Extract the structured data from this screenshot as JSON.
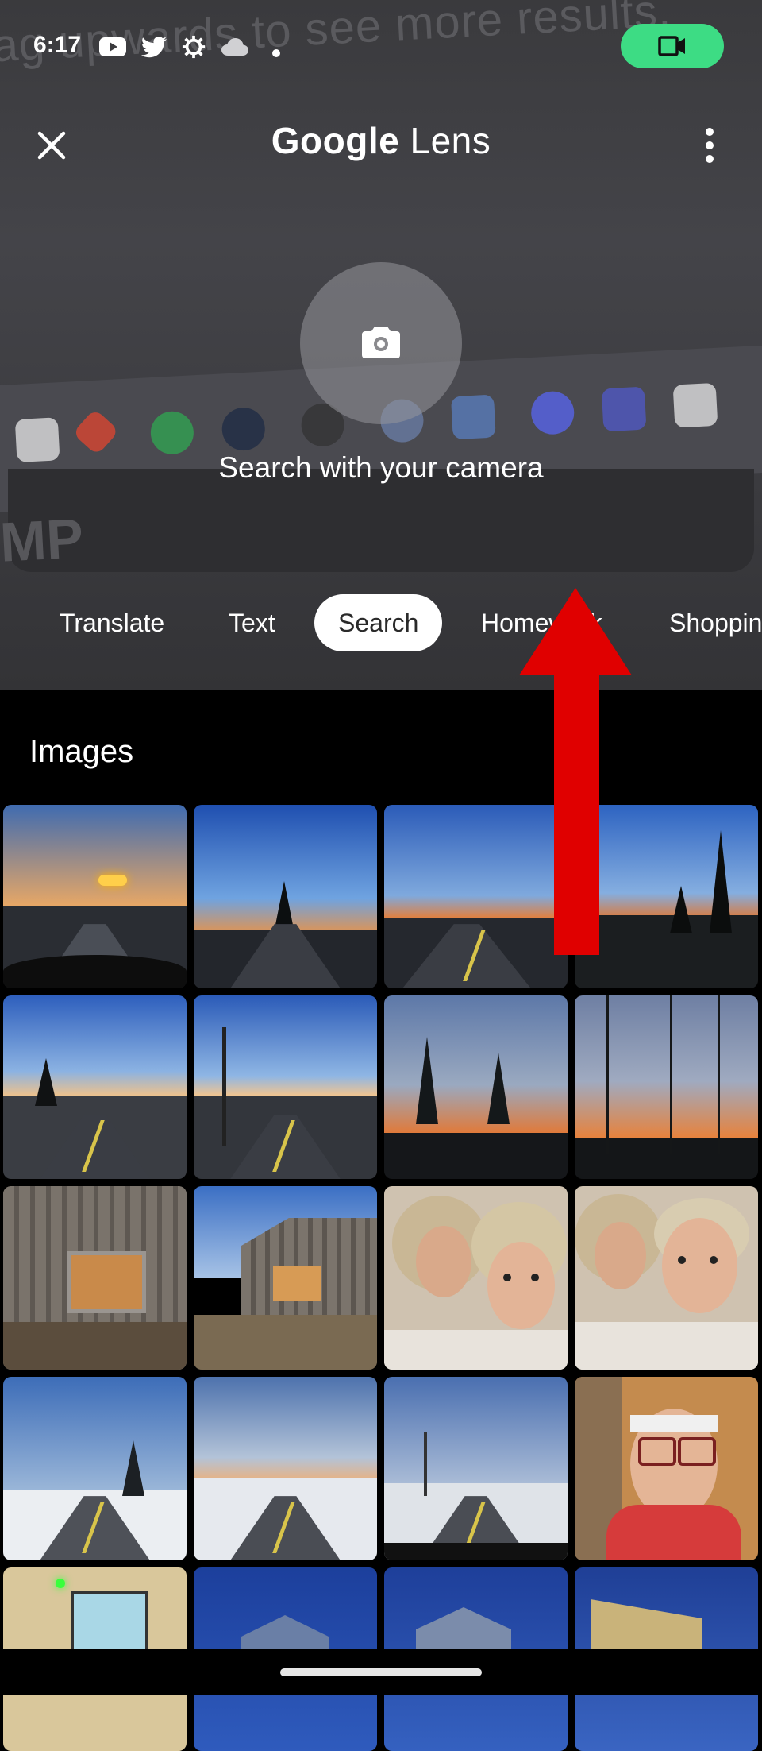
{
  "status_bar": {
    "time": "6:17",
    "icons": [
      "youtube-icon",
      "twitter-icon",
      "settings-gear-icon",
      "cloud-icon",
      "dot-icon"
    ],
    "camera_indicator_color": "#3ddc84"
  },
  "header": {
    "title_brand": "Google",
    "title_product": "Lens",
    "close_icon": "close-icon",
    "more_icon": "more-vert-icon"
  },
  "viewfinder": {
    "background_text": "ag upwards to see more results.",
    "background_text2": "MP",
    "shutter_icon": "camera-icon",
    "prompt": "Search with your camera"
  },
  "modes": {
    "items": [
      "Translate",
      "Text",
      "Search",
      "Homework",
      "Shopping"
    ],
    "active": "Search"
  },
  "overlay": {
    "arrow_color": "#e00000"
  },
  "results": {
    "section_label": "Images",
    "tiles": [
      "night-highway-headlights",
      "dusk-road-trees",
      "sunset-highway",
      "sunset-road-trees",
      "twilight-road-1",
      "twilight-road-2",
      "sunset-bare-trees-1",
      "sunset-bare-trees-2",
      "old-barn-1",
      "old-barn-2",
      "couple-selfie-1",
      "couple-selfie-2",
      "winter-road-1",
      "winter-road-2",
      "winter-road-3",
      "man-with-headlamp",
      "battery-display",
      "blue-houses-1",
      "blue-houses-2",
      "blue-houses-3"
    ]
  }
}
